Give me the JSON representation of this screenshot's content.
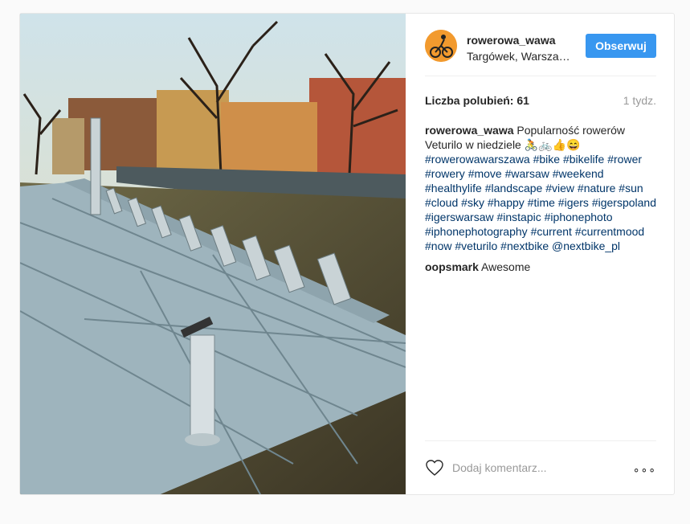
{
  "post": {
    "username": "rowerowa_wawa",
    "location": "Targówek, Warsza…",
    "follow_label": "Obserwuj",
    "likes_label": "Liczba polubień: 61",
    "time_ago": "1 tydz."
  },
  "caption": {
    "user": "rowerowa_wawa",
    "text_plain": "Popularność rowerów Veturilo w niedziele 🚴🚲👍😄",
    "tags": [
      "#rowerowawarszawa",
      "#bike",
      "#bikelife",
      "#rower",
      "#rowery",
      "#move",
      "#warsaw",
      "#weekend",
      "#healthylife",
      "#landscape",
      "#view",
      "#nature",
      "#sun",
      "#cloud",
      "#sky",
      "#happy",
      "#time",
      "#igers",
      "#igerspoland",
      "#igerswarsaw",
      "#instapic",
      "#iphonephoto",
      "#iphonephotography",
      "#current",
      "#currentmood",
      "#now",
      "#veturilo",
      "#nextbike",
      "@nextbike_pl"
    ]
  },
  "comment": {
    "user": "oopsmark",
    "text": "Awesome"
  },
  "footer": {
    "add_comment_placeholder": "Dodaj komentarz...",
    "more_label": "∘∘∘",
    "heart_icon": "heart-icon"
  },
  "colors": {
    "follow_button": "#3897f0",
    "tag": "#003569",
    "avatar": "#f29a2e"
  }
}
